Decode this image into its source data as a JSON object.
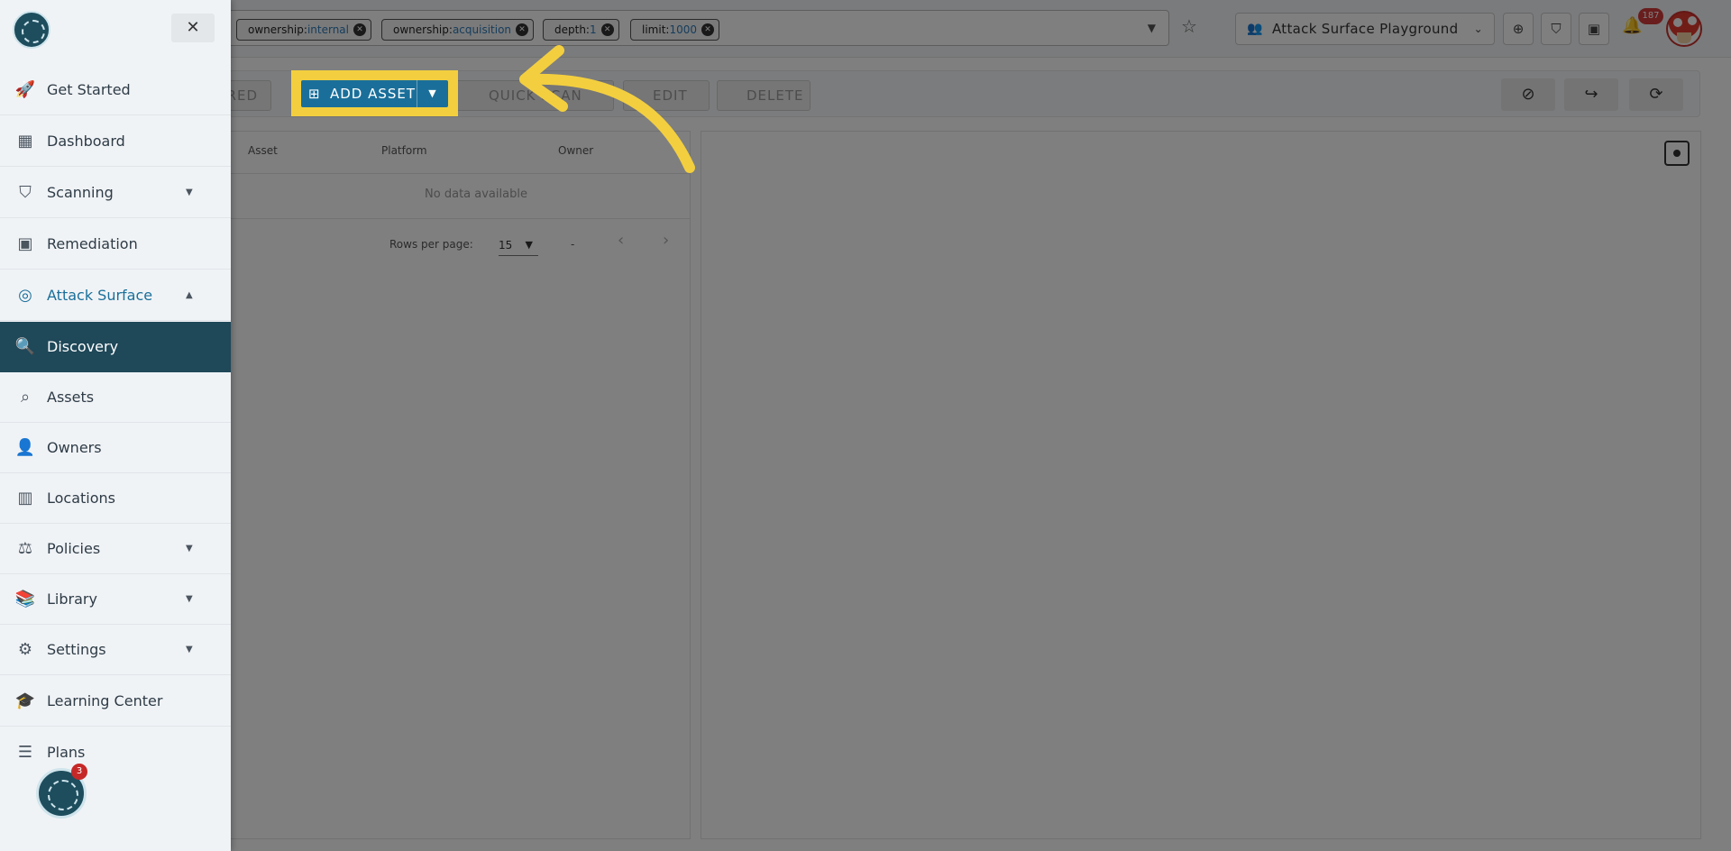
{
  "filters": [
    {
      "key": "ownership:",
      "value": "internal"
    },
    {
      "key": "ownership:",
      "value": "acquisition"
    },
    {
      "key": "depth:",
      "value": "1"
    },
    {
      "key": "limit:",
      "value": "1000"
    }
  ],
  "header": {
    "workspace": "Attack Surface Playground",
    "notification_count": "187"
  },
  "toolbar": {
    "partial_button": "RED",
    "add_asset": "ADD ASSET",
    "quick_scan": "QUICK SCAN",
    "edit": "EDIT",
    "delete": "DELETE"
  },
  "table": {
    "columns": [
      "Asset",
      "Platform",
      "Owner"
    ],
    "empty_message": "No data available",
    "rows_per_page_label": "Rows per page:",
    "rows_per_page_value": "15",
    "page_range": "-"
  },
  "sidebar": {
    "items": [
      {
        "label": "Get Started",
        "icon": "rocket-icon"
      },
      {
        "label": "Dashboard",
        "icon": "dashboard-icon"
      },
      {
        "label": "Scanning",
        "icon": "shield-icon"
      },
      {
        "label": "Remediation",
        "icon": "ticket-icon"
      },
      {
        "label": "Attack Surface",
        "icon": "radar-icon"
      },
      {
        "label": "Discovery",
        "icon": "search-globe-icon"
      },
      {
        "label": "Assets",
        "icon": "asset-search-icon"
      },
      {
        "label": "Owners",
        "icon": "user-gear-icon"
      },
      {
        "label": "Locations",
        "icon": "building-icon"
      },
      {
        "label": "Policies",
        "icon": "gavel-icon"
      },
      {
        "label": "Library",
        "icon": "books-icon"
      },
      {
        "label": "Settings",
        "icon": "gear-icon"
      },
      {
        "label": "Learning Center",
        "icon": "graduation-cap-icon"
      },
      {
        "label": "Plans",
        "icon": "list-icon"
      }
    ],
    "help_badge": "3"
  },
  "colors": {
    "accent": "#1a6f9a",
    "active_nav": "#1f4859",
    "highlight": "#f3cf3f"
  }
}
